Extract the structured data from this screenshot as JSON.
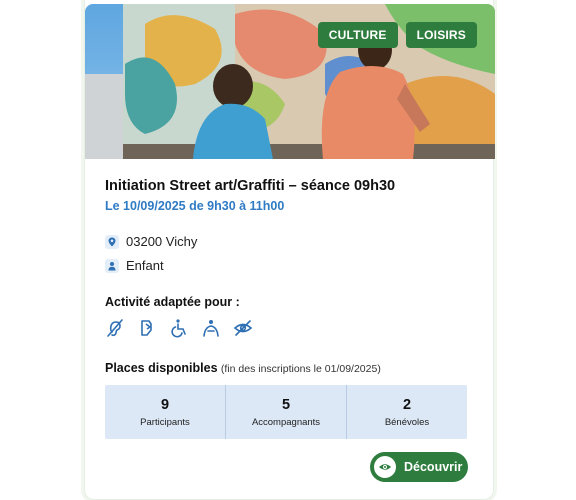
{
  "card": {
    "tags": [
      "CULTURE",
      "LOISIRS"
    ],
    "title": "Initiation Street art/Graffiti – séance 09h30",
    "date": "Le 10/09/2025 de 9h30 à 11h00",
    "location": "03200 Vichy",
    "audience": "Enfant",
    "adapted_label": "Activité adaptée pour :",
    "adapted_icons": [
      "hearing-impaired-icon",
      "sign-language-icon",
      "wheelchair-icon",
      "intellectual-disability-icon",
      "visually-impaired-icon"
    ],
    "places_label": "Places disponibles",
    "places_note": "(fin des inscriptions le 01/09/2025)",
    "stats": [
      {
        "value": "9",
        "label": "Participants"
      },
      {
        "value": "5",
        "label": "Accompagnants"
      },
      {
        "value": "2",
        "label": "Bénévoles"
      }
    ],
    "discover_label": "Découvrir"
  },
  "colors": {
    "accent_green": "#2e7d3e",
    "date_blue": "#2f7bc4",
    "icon_blue": "#2f6fb3",
    "stats_bg": "#dde8f6"
  }
}
